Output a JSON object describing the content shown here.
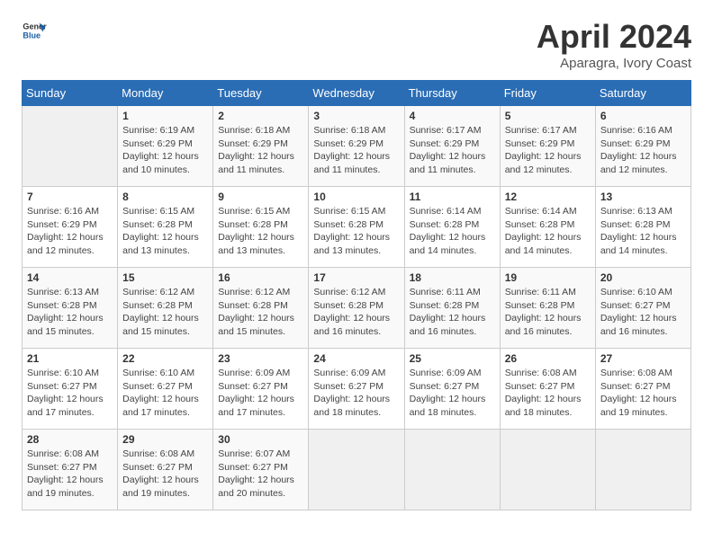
{
  "logo": {
    "general": "General",
    "blue": "Blue"
  },
  "title": "April 2024",
  "subtitle": "Aparagra, Ivory Coast",
  "days_header": [
    "Sunday",
    "Monday",
    "Tuesday",
    "Wednesday",
    "Thursday",
    "Friday",
    "Saturday"
  ],
  "weeks": [
    [
      {
        "day": "",
        "info": ""
      },
      {
        "day": "1",
        "info": "Sunrise: 6:19 AM\nSunset: 6:29 PM\nDaylight: 12 hours\nand 10 minutes."
      },
      {
        "day": "2",
        "info": "Sunrise: 6:18 AM\nSunset: 6:29 PM\nDaylight: 12 hours\nand 11 minutes."
      },
      {
        "day": "3",
        "info": "Sunrise: 6:18 AM\nSunset: 6:29 PM\nDaylight: 12 hours\nand 11 minutes."
      },
      {
        "day": "4",
        "info": "Sunrise: 6:17 AM\nSunset: 6:29 PM\nDaylight: 12 hours\nand 11 minutes."
      },
      {
        "day": "5",
        "info": "Sunrise: 6:17 AM\nSunset: 6:29 PM\nDaylight: 12 hours\nand 12 minutes."
      },
      {
        "day": "6",
        "info": "Sunrise: 6:16 AM\nSunset: 6:29 PM\nDaylight: 12 hours\nand 12 minutes."
      }
    ],
    [
      {
        "day": "7",
        "info": "Sunrise: 6:16 AM\nSunset: 6:29 PM\nDaylight: 12 hours\nand 12 minutes."
      },
      {
        "day": "8",
        "info": "Sunrise: 6:15 AM\nSunset: 6:28 PM\nDaylight: 12 hours\nand 13 minutes."
      },
      {
        "day": "9",
        "info": "Sunrise: 6:15 AM\nSunset: 6:28 PM\nDaylight: 12 hours\nand 13 minutes."
      },
      {
        "day": "10",
        "info": "Sunrise: 6:15 AM\nSunset: 6:28 PM\nDaylight: 12 hours\nand 13 minutes."
      },
      {
        "day": "11",
        "info": "Sunrise: 6:14 AM\nSunset: 6:28 PM\nDaylight: 12 hours\nand 14 minutes."
      },
      {
        "day": "12",
        "info": "Sunrise: 6:14 AM\nSunset: 6:28 PM\nDaylight: 12 hours\nand 14 minutes."
      },
      {
        "day": "13",
        "info": "Sunrise: 6:13 AM\nSunset: 6:28 PM\nDaylight: 12 hours\nand 14 minutes."
      }
    ],
    [
      {
        "day": "14",
        "info": "Sunrise: 6:13 AM\nSunset: 6:28 PM\nDaylight: 12 hours\nand 15 minutes."
      },
      {
        "day": "15",
        "info": "Sunrise: 6:12 AM\nSunset: 6:28 PM\nDaylight: 12 hours\nand 15 minutes."
      },
      {
        "day": "16",
        "info": "Sunrise: 6:12 AM\nSunset: 6:28 PM\nDaylight: 12 hours\nand 15 minutes."
      },
      {
        "day": "17",
        "info": "Sunrise: 6:12 AM\nSunset: 6:28 PM\nDaylight: 12 hours\nand 16 minutes."
      },
      {
        "day": "18",
        "info": "Sunrise: 6:11 AM\nSunset: 6:28 PM\nDaylight: 12 hours\nand 16 minutes."
      },
      {
        "day": "19",
        "info": "Sunrise: 6:11 AM\nSunset: 6:28 PM\nDaylight: 12 hours\nand 16 minutes."
      },
      {
        "day": "20",
        "info": "Sunrise: 6:10 AM\nSunset: 6:27 PM\nDaylight: 12 hours\nand 16 minutes."
      }
    ],
    [
      {
        "day": "21",
        "info": "Sunrise: 6:10 AM\nSunset: 6:27 PM\nDaylight: 12 hours\nand 17 minutes."
      },
      {
        "day": "22",
        "info": "Sunrise: 6:10 AM\nSunset: 6:27 PM\nDaylight: 12 hours\nand 17 minutes."
      },
      {
        "day": "23",
        "info": "Sunrise: 6:09 AM\nSunset: 6:27 PM\nDaylight: 12 hours\nand 17 minutes."
      },
      {
        "day": "24",
        "info": "Sunrise: 6:09 AM\nSunset: 6:27 PM\nDaylight: 12 hours\nand 18 minutes."
      },
      {
        "day": "25",
        "info": "Sunrise: 6:09 AM\nSunset: 6:27 PM\nDaylight: 12 hours\nand 18 minutes."
      },
      {
        "day": "26",
        "info": "Sunrise: 6:08 AM\nSunset: 6:27 PM\nDaylight: 12 hours\nand 18 minutes."
      },
      {
        "day": "27",
        "info": "Sunrise: 6:08 AM\nSunset: 6:27 PM\nDaylight: 12 hours\nand 19 minutes."
      }
    ],
    [
      {
        "day": "28",
        "info": "Sunrise: 6:08 AM\nSunset: 6:27 PM\nDaylight: 12 hours\nand 19 minutes."
      },
      {
        "day": "29",
        "info": "Sunrise: 6:08 AM\nSunset: 6:27 PM\nDaylight: 12 hours\nand 19 minutes."
      },
      {
        "day": "30",
        "info": "Sunrise: 6:07 AM\nSunset: 6:27 PM\nDaylight: 12 hours\nand 20 minutes."
      },
      {
        "day": "",
        "info": ""
      },
      {
        "day": "",
        "info": ""
      },
      {
        "day": "",
        "info": ""
      },
      {
        "day": "",
        "info": ""
      }
    ]
  ]
}
